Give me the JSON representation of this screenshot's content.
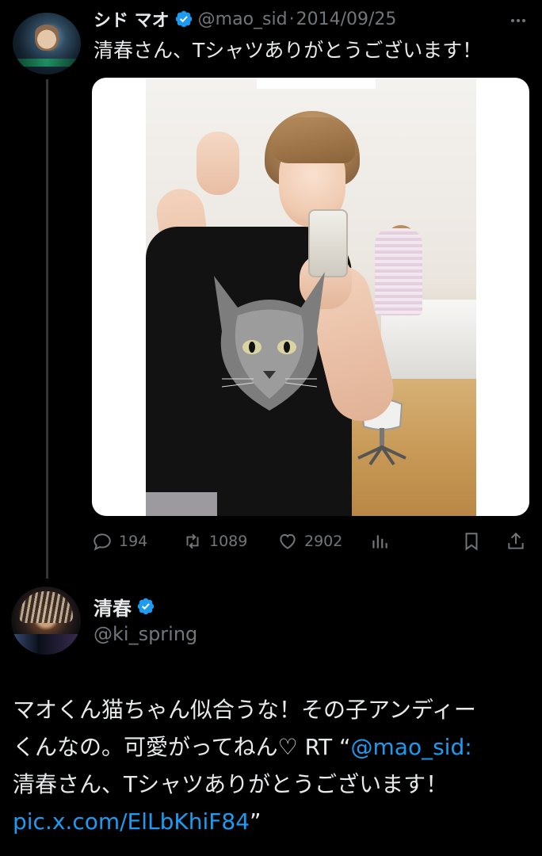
{
  "tweet1": {
    "display_name": "シド マオ",
    "handle": "@mao_sid",
    "separator": "·",
    "date": "2014/09/25",
    "text": "清春さん、Tシャツありがとうございます！",
    "actions": {
      "replies": "194",
      "retweets": "1089",
      "likes": "2902"
    }
  },
  "tweet2": {
    "display_name": "清春",
    "handle": "@ki_spring",
    "text_line1": "マオくん猫ちゃん似合うな！その子アンディー",
    "text_line2_prefix": "くんなの。可愛がってねん♡ RT “",
    "mention": "@mao_sid",
    "text_line2_suffix": ":",
    "text_line3": "清春さん、Tシャツありがとうございます！",
    "link": "pic.x.com/ElLbKhiF84",
    "text_line4_suffix": "”"
  },
  "icons": {
    "verified": "verified-badge-icon",
    "more": "more-options-icon",
    "reply": "reply-icon",
    "retweet": "retweet-icon",
    "like": "heart-icon",
    "views": "analytics-icon",
    "bookmark": "bookmark-icon",
    "share": "share-icon"
  },
  "colors": {
    "background": "#000000",
    "text": "#e7e9ea",
    "secondary": "#71767b",
    "link": "#1d9bf0",
    "verified": "#1d9bf0"
  }
}
